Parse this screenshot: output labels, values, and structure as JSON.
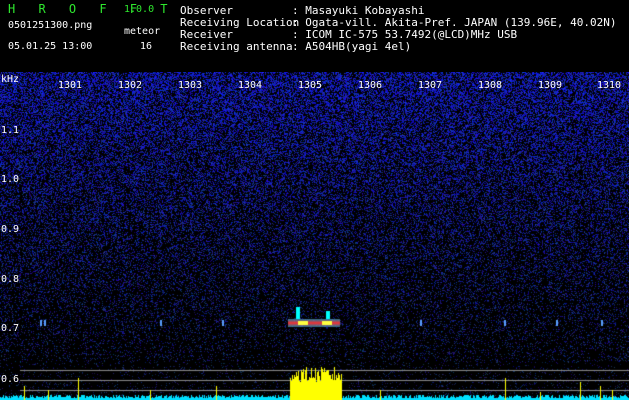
{
  "header": {
    "brand": "H R O F F T",
    "version": "1.0.0",
    "filename": "0501251300.png",
    "datetime": "05.01.25 13:00",
    "meteor_label": "meteor",
    "meteor_count": "16"
  },
  "info": [
    {
      "label": "Observer",
      "value": ": Masayuki Kobayashi"
    },
    {
      "label": "Receiving Location",
      "value": ": Ogata-vill. Akita-Pref. JAPAN (139.96E, 40.02N)"
    },
    {
      "label": "Receiver",
      "value": ": ICOM IC-575 53.7492(@LCD)MHz USB"
    },
    {
      "label": "Receiving antenna",
      "value": ": A504HB(yagi 4el)"
    }
  ],
  "chart_data": {
    "type": "heatmap",
    "x_unit": "time (HHMM)",
    "x_ticks": [
      "1301",
      "1302",
      "1303",
      "1304",
      "1305",
      "1306",
      "1307",
      "1308",
      "1309",
      "1310"
    ],
    "y_unit": "kHz",
    "y_ticks": [
      "1.1",
      "1.0",
      "0.9",
      "0.8",
      "0.7",
      "0.6"
    ],
    "ylim": [
      0.58,
      1.2
    ],
    "meteor_echo_band_khz": 0.72,
    "strong_echo_time": "1305"
  },
  "colors": {
    "background": "#000000",
    "noise": "#1a2bd8",
    "echo": "#ff2a2a",
    "count_trace": "#ffff00",
    "baseline": "#00e0ff",
    "text_green": "#2ee82e",
    "text_white": "#ffffff"
  }
}
